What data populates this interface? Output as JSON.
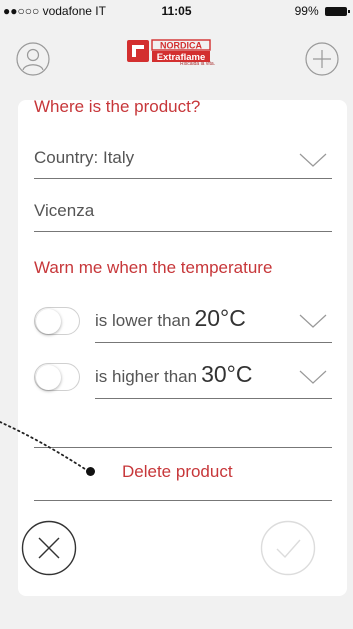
{
  "status_bar": {
    "carrier": "●●○○○ vodafone IT",
    "time": "11:05",
    "battery": "99%"
  },
  "header": {
    "logo_text": "NORDICA Extraflame",
    "logo_tagline": "Riscalda la vita.",
    "left_icon": "user-icon",
    "right_icon": "plus-icon"
  },
  "location": {
    "title": "Where is the product?",
    "country": "Country: Italy",
    "city": "Vicenza"
  },
  "temperature": {
    "title": "Warn me when the temperature",
    "lower_label": "is lower than",
    "lower_value": "20°C",
    "higher_label": "is higher than",
    "higher_value": "30°C"
  },
  "actions": {
    "delete_label": "Delete product",
    "cancel_icon": "close-circle-icon",
    "confirm_icon": "check-circle-icon"
  },
  "colors": {
    "accent": "#c7373a",
    "logo_red": "#d32f2f"
  }
}
